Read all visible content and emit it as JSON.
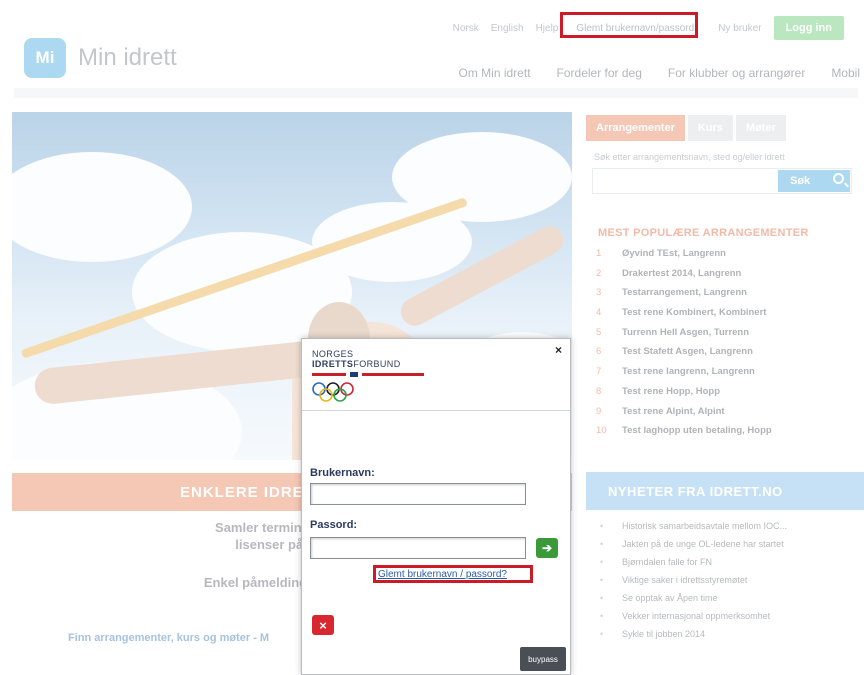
{
  "topnav": {
    "norsk": "Norsk",
    "english": "English",
    "help": "Hjelp",
    "forgot": "Glemt brukernavn/passord",
    "new_user": "Ny bruker",
    "login": "Logg inn"
  },
  "logo": {
    "badge": "Mi",
    "name": "Min idrett"
  },
  "mainnav": [
    "Om Min idrett",
    "Fordeler for deg",
    "For klubber og arrangører",
    "Mobil"
  ],
  "hero": {
    "banner": "ENKLERE IDRET",
    "desc_line1": "Samler terminlister, aktiv",
    "desc_line2": "lisenser på tvers a",
    "desc_line3": "Enkel påmelding og betaling",
    "link": "Finn arrangementer, kurs og møter - M"
  },
  "sidebar": {
    "tabs": [
      "Arrangementer",
      "Kurs",
      "Møter"
    ],
    "search_hint": "Søk etter arrangementsnavn, sted og/eller idrett",
    "search_button": "Søk",
    "popular_title": "MEST POPULÆRE ARRANGEMENTER",
    "popular": [
      {
        "n": "1",
        "t": "Øyvind TEst, Langrenn"
      },
      {
        "n": "2",
        "t": "Drakertest 2014, Langrenn"
      },
      {
        "n": "3",
        "t": "Testarrangement, Langrenn"
      },
      {
        "n": "4",
        "t": "Test rene Kombinert, Kombinert"
      },
      {
        "n": "5",
        "t": "Turrenn Hell Asgen, Turrenn"
      },
      {
        "n": "6",
        "t": "Test Stafett Asgen, Langrenn"
      },
      {
        "n": "7",
        "t": "Test rene langrenn, Langrenn"
      },
      {
        "n": "8",
        "t": "Test rene Hopp, Hopp"
      },
      {
        "n": "9",
        "t": "Test rene Alpint, Alpint"
      },
      {
        "n": "10",
        "t": "Test laghopp uten betaling, Hopp"
      }
    ],
    "news_title": "NYHETER FRA IDRETT.NO",
    "news": [
      "Historisk samarbeidsavtale mellom IOC...",
      "Jakten på de unge OL-ledene har startet",
      "Bjørndalen falle for FN",
      "Viktige saker i idrettsstyremøtet",
      "Se opptak av Åpen time",
      "Vekker internasjonal oppmerksomhet",
      "Sykle til jobben 2014"
    ]
  },
  "modal": {
    "org_line1": "NORGES",
    "org_line2_bold": "IDRETTS",
    "org_line2_rest": "FORBUND",
    "close": "×",
    "username_label": "Brukernavn:",
    "username_value": "",
    "password_label": "Passord:",
    "password_value": "",
    "go": "➔",
    "forgot_link": "Glemt brukernavn / passord?",
    "cancel": "×",
    "provider": "buypass"
  }
}
